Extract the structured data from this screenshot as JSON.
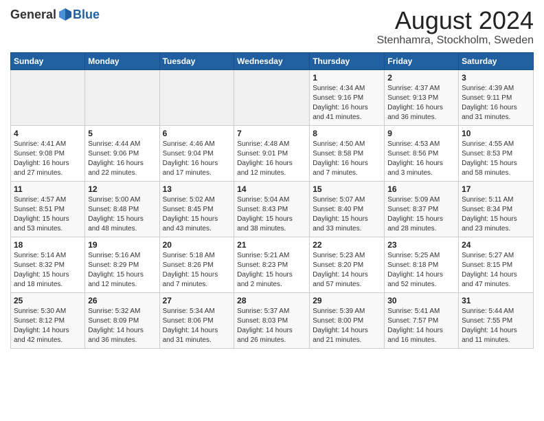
{
  "header": {
    "logo_general": "General",
    "logo_blue": "Blue",
    "main_title": "August 2024",
    "subtitle": "Stenhamra, Stockholm, Sweden"
  },
  "weekdays": [
    "Sunday",
    "Monday",
    "Tuesday",
    "Wednesday",
    "Thursday",
    "Friday",
    "Saturday"
  ],
  "weeks": [
    [
      {
        "day": "",
        "info": ""
      },
      {
        "day": "",
        "info": ""
      },
      {
        "day": "",
        "info": ""
      },
      {
        "day": "",
        "info": ""
      },
      {
        "day": "1",
        "info": "Sunrise: 4:34 AM\nSunset: 9:16 PM\nDaylight: 16 hours\nand 41 minutes."
      },
      {
        "day": "2",
        "info": "Sunrise: 4:37 AM\nSunset: 9:13 PM\nDaylight: 16 hours\nand 36 minutes."
      },
      {
        "day": "3",
        "info": "Sunrise: 4:39 AM\nSunset: 9:11 PM\nDaylight: 16 hours\nand 31 minutes."
      }
    ],
    [
      {
        "day": "4",
        "info": "Sunrise: 4:41 AM\nSunset: 9:08 PM\nDaylight: 16 hours\nand 27 minutes."
      },
      {
        "day": "5",
        "info": "Sunrise: 4:44 AM\nSunset: 9:06 PM\nDaylight: 16 hours\nand 22 minutes."
      },
      {
        "day": "6",
        "info": "Sunrise: 4:46 AM\nSunset: 9:04 PM\nDaylight: 16 hours\nand 17 minutes."
      },
      {
        "day": "7",
        "info": "Sunrise: 4:48 AM\nSunset: 9:01 PM\nDaylight: 16 hours\nand 12 minutes."
      },
      {
        "day": "8",
        "info": "Sunrise: 4:50 AM\nSunset: 8:58 PM\nDaylight: 16 hours\nand 7 minutes."
      },
      {
        "day": "9",
        "info": "Sunrise: 4:53 AM\nSunset: 8:56 PM\nDaylight: 16 hours\nand 3 minutes."
      },
      {
        "day": "10",
        "info": "Sunrise: 4:55 AM\nSunset: 8:53 PM\nDaylight: 15 hours\nand 58 minutes."
      }
    ],
    [
      {
        "day": "11",
        "info": "Sunrise: 4:57 AM\nSunset: 8:51 PM\nDaylight: 15 hours\nand 53 minutes."
      },
      {
        "day": "12",
        "info": "Sunrise: 5:00 AM\nSunset: 8:48 PM\nDaylight: 15 hours\nand 48 minutes."
      },
      {
        "day": "13",
        "info": "Sunrise: 5:02 AM\nSunset: 8:45 PM\nDaylight: 15 hours\nand 43 minutes."
      },
      {
        "day": "14",
        "info": "Sunrise: 5:04 AM\nSunset: 8:43 PM\nDaylight: 15 hours\nand 38 minutes."
      },
      {
        "day": "15",
        "info": "Sunrise: 5:07 AM\nSunset: 8:40 PM\nDaylight: 15 hours\nand 33 minutes."
      },
      {
        "day": "16",
        "info": "Sunrise: 5:09 AM\nSunset: 8:37 PM\nDaylight: 15 hours\nand 28 minutes."
      },
      {
        "day": "17",
        "info": "Sunrise: 5:11 AM\nSunset: 8:34 PM\nDaylight: 15 hours\nand 23 minutes."
      }
    ],
    [
      {
        "day": "18",
        "info": "Sunrise: 5:14 AM\nSunset: 8:32 PM\nDaylight: 15 hours\nand 18 minutes."
      },
      {
        "day": "19",
        "info": "Sunrise: 5:16 AM\nSunset: 8:29 PM\nDaylight: 15 hours\nand 12 minutes."
      },
      {
        "day": "20",
        "info": "Sunrise: 5:18 AM\nSunset: 8:26 PM\nDaylight: 15 hours\nand 7 minutes."
      },
      {
        "day": "21",
        "info": "Sunrise: 5:21 AM\nSunset: 8:23 PM\nDaylight: 15 hours\nand 2 minutes."
      },
      {
        "day": "22",
        "info": "Sunrise: 5:23 AM\nSunset: 8:20 PM\nDaylight: 14 hours\nand 57 minutes."
      },
      {
        "day": "23",
        "info": "Sunrise: 5:25 AM\nSunset: 8:18 PM\nDaylight: 14 hours\nand 52 minutes."
      },
      {
        "day": "24",
        "info": "Sunrise: 5:27 AM\nSunset: 8:15 PM\nDaylight: 14 hours\nand 47 minutes."
      }
    ],
    [
      {
        "day": "25",
        "info": "Sunrise: 5:30 AM\nSunset: 8:12 PM\nDaylight: 14 hours\nand 42 minutes."
      },
      {
        "day": "26",
        "info": "Sunrise: 5:32 AM\nSunset: 8:09 PM\nDaylight: 14 hours\nand 36 minutes."
      },
      {
        "day": "27",
        "info": "Sunrise: 5:34 AM\nSunset: 8:06 PM\nDaylight: 14 hours\nand 31 minutes."
      },
      {
        "day": "28",
        "info": "Sunrise: 5:37 AM\nSunset: 8:03 PM\nDaylight: 14 hours\nand 26 minutes."
      },
      {
        "day": "29",
        "info": "Sunrise: 5:39 AM\nSunset: 8:00 PM\nDaylight: 14 hours\nand 21 minutes."
      },
      {
        "day": "30",
        "info": "Sunrise: 5:41 AM\nSunset: 7:57 PM\nDaylight: 14 hours\nand 16 minutes."
      },
      {
        "day": "31",
        "info": "Sunrise: 5:44 AM\nSunset: 7:55 PM\nDaylight: 14 hours\nand 11 minutes."
      }
    ]
  ]
}
